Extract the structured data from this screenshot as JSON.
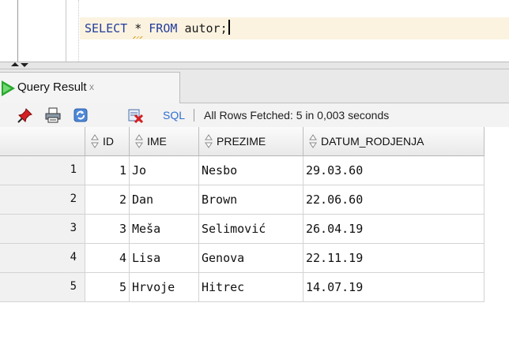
{
  "editor": {
    "sql_keyword_select": "SELECT",
    "sql_star": "*",
    "sql_keyword_from": "FROM",
    "sql_rest": "autor;"
  },
  "tab": {
    "label": "Query Result",
    "close": "x"
  },
  "toolbar": {
    "sql_label": "SQL",
    "status": "All Rows Fetched: 5 in 0,003 seconds",
    "icons": [
      "pin-icon",
      "print-icon",
      "refresh-icon",
      "delete-icon"
    ]
  },
  "grid": {
    "columns": [
      "ID",
      "IME",
      "PREZIME",
      "DATUM_RODJENJA"
    ],
    "rows": [
      {
        "num": "1",
        "id": "1",
        "ime": "Jo",
        "prezime": "Nesbo",
        "datum": "29.03.60"
      },
      {
        "num": "2",
        "id": "2",
        "ime": "Dan",
        "prezime": "Brown",
        "datum": "22.06.60"
      },
      {
        "num": "3",
        "id": "3",
        "ime": "Meša",
        "prezime": "Selimović",
        "datum": "26.04.19"
      },
      {
        "num": "4",
        "id": "4",
        "ime": "Lisa",
        "prezime": "Genova",
        "datum": "22.11.19"
      },
      {
        "num": "5",
        "id": "5",
        "ime": "Hrvoje",
        "prezime": "Hitrec",
        "datum": "14.07.19"
      }
    ]
  },
  "colors": {
    "keyword": "#233c9c",
    "current_line": "#fbf3e0",
    "run_green": "#27a82c",
    "sql_link": "#2f6fd0"
  }
}
